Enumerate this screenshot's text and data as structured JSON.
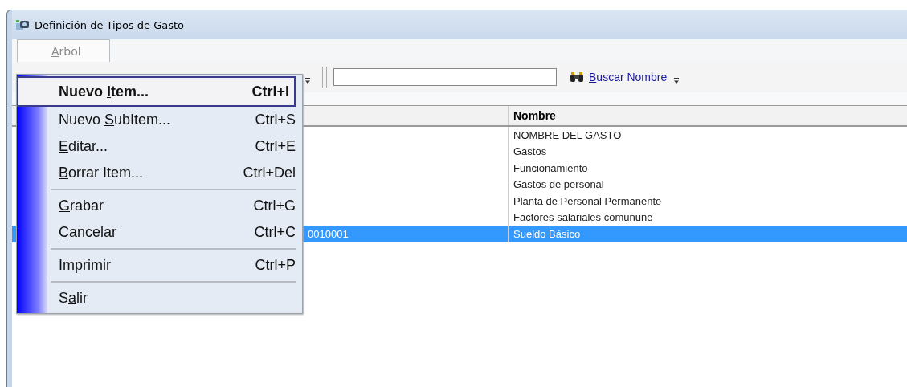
{
  "window": {
    "title": "Definición de Tipos de Gasto"
  },
  "menu_bar": [
    {
      "mnemonic": "A",
      "text_after": "rbol",
      "selected": true
    }
  ],
  "menu": [
    {
      "kind": "item",
      "text_before": "Nuevo ",
      "mnemonic": "I",
      "text_after": "tem...",
      "shortcut": "Ctrl+I",
      "selected": true
    },
    {
      "kind": "item",
      "text_before": "Nuevo ",
      "mnemonic": "S",
      "text_after": "ubItem...",
      "shortcut": "Ctrl+S",
      "selected": false
    },
    {
      "kind": "item",
      "mnemonic": "E",
      "text_after": "ditar...",
      "shortcut": "Ctrl+E",
      "selected": false
    },
    {
      "kind": "item",
      "mnemonic": "B",
      "text_after": "orrar Item...",
      "shortcut": "Ctrl+Del",
      "selected": false
    },
    {
      "kind": "separator"
    },
    {
      "kind": "item",
      "mnemonic": "G",
      "text_after": "rabar",
      "shortcut": "Ctrl+G",
      "selected": false
    },
    {
      "kind": "item",
      "mnemonic": "C",
      "text_after": "ancelar",
      "shortcut": "Ctrl+C",
      "selected": false
    },
    {
      "kind": "separator"
    },
    {
      "kind": "item",
      "text_before": "Im",
      "mnemonic": "p",
      "text_after": "rimir",
      "shortcut": "Ctrl+P",
      "selected": false
    },
    {
      "kind": "separator"
    },
    {
      "kind": "item",
      "text_before": "S",
      "mnemonic": "a",
      "text_after": "lir",
      "selected": false
    }
  ],
  "toolbar": {
    "search_link": {
      "mnemonic": "B",
      "text_after": "uscar Nombre"
    }
  },
  "table": {
    "column_2_heading": "Nombre",
    "rows": [
      {
        "nombre": "NOMBRE DEL GASTO",
        "selected": false
      },
      {
        "nombre": "Gastos",
        "selected": false
      },
      {
        "nombre": "Funcionamiento",
        "selected": false
      },
      {
        "nombre": "Gastos de personal",
        "selected": false
      },
      {
        "nombre": "Planta de Personal Permanente",
        "selected": false
      },
      {
        "nombre": "Factores salariales comunune",
        "selected": false
      },
      {
        "column_1": "0010001",
        "nombre": "Sueldo Básico",
        "selected": true
      }
    ]
  }
}
